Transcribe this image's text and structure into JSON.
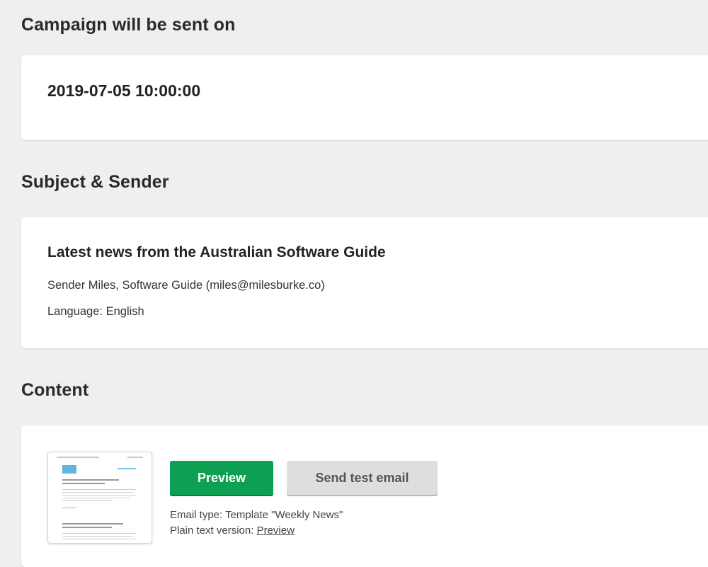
{
  "schedule": {
    "title": "Campaign will be sent on",
    "datetime": "2019-07-05 10:00:00"
  },
  "subject_sender": {
    "title": "Subject & Sender",
    "subject": "Latest news from the Australian Software Guide",
    "sender": "Sender Miles, Software Guide (miles@milesburke.co)",
    "language": "Language: English"
  },
  "content": {
    "title": "Content",
    "preview_button": "Preview",
    "test_email_button": "Send test email",
    "email_type": "Email type: Template \"Weekly News\"",
    "plain_text_label": "Plain text version:",
    "plain_text_link": "Preview"
  },
  "colors": {
    "background": "#efefef",
    "card": "#ffffff",
    "primary_button": "#0ea052",
    "secondary_button": "#dedede"
  }
}
